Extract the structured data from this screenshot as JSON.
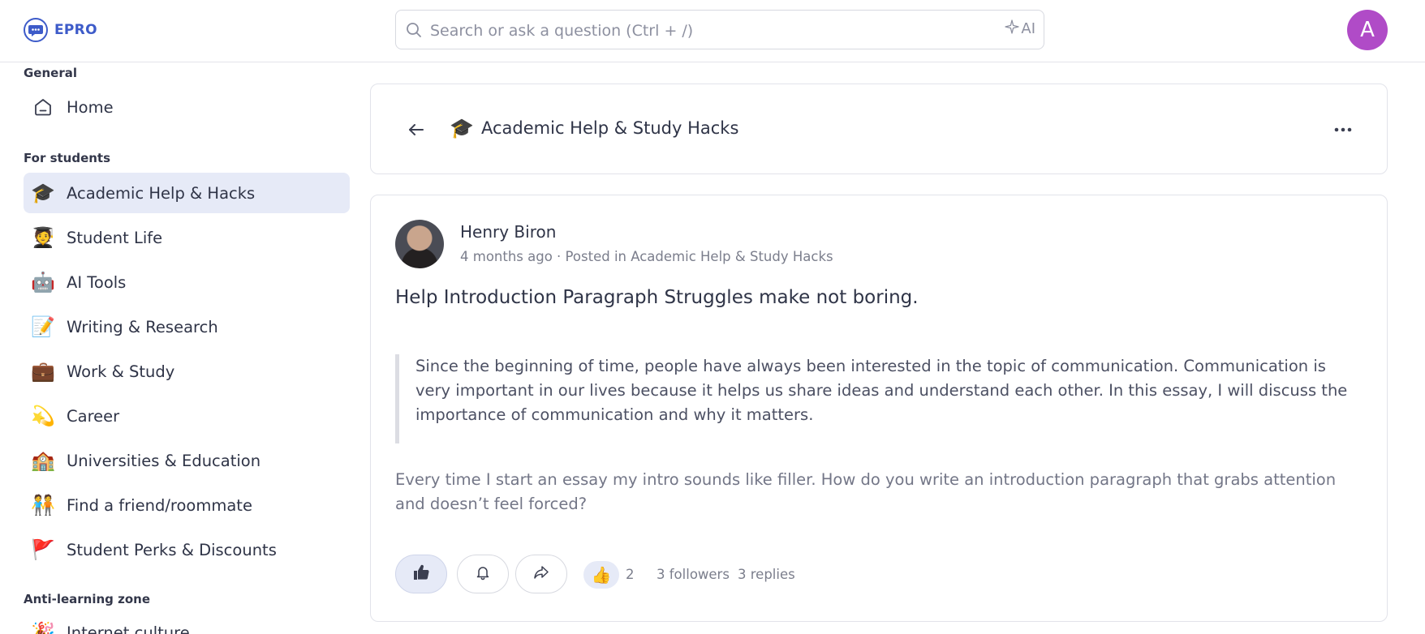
{
  "brand": {
    "name": "EPRO",
    "color": "#3d5bc9"
  },
  "search": {
    "placeholder": "Search or ask a question (Ctrl + /)",
    "ai_label": "AI"
  },
  "user": {
    "avatar_letter": "A",
    "avatar_color": "#b04bc7"
  },
  "sidebar": {
    "sections": [
      {
        "heading": "General"
      },
      {
        "heading": "For students"
      },
      {
        "heading": "Anti-learning zone"
      }
    ],
    "items": [
      {
        "label": "Home",
        "icon": "home-icon"
      },
      {
        "label": "Academic Help & Hacks",
        "icon": "graduation-cap-icon",
        "emoji": "🎓",
        "active": true
      },
      {
        "label": "Student Life",
        "icon": "student-icon",
        "emoji": "🧑‍🎓"
      },
      {
        "label": "AI Tools",
        "icon": "robot-icon",
        "emoji": "🤖"
      },
      {
        "label": "Writing & Research",
        "icon": "memo-icon",
        "emoji": "📝"
      },
      {
        "label": "Work & Study",
        "icon": "briefcase-icon",
        "emoji": "💼"
      },
      {
        "label": "Career",
        "icon": "dizzy-star-icon",
        "emoji": "💫"
      },
      {
        "label": "Universities & Education",
        "icon": "school-icon",
        "emoji": "🏫"
      },
      {
        "label": "Find a friend/roommate",
        "icon": "people-icon",
        "emoji": "🧑‍🤝‍🧑"
      },
      {
        "label": "Student Perks & Discounts",
        "icon": "flag-icon",
        "emoji": "🚩"
      },
      {
        "label": "Internet culture",
        "icon": "party-icon",
        "emoji": "🎉"
      }
    ]
  },
  "header": {
    "emoji": "🎓",
    "title": "Academic Help & Study Hacks"
  },
  "post": {
    "author": "Henry Biron",
    "meta": "4 months ago · Posted in Academic Help & Study Hacks",
    "title": "Help Introduction Paragraph Struggles make not boring.",
    "quote": "Since the beginning of time, people have always been interested in the topic of communication. Communication is very important in our lives because it helps us share ideas and understand each other. In this essay, I will discuss the importance of communication and why it matters.",
    "body": "Every time I start an essay my intro sounds like filler. How do you write an introduction paragraph that grabs attention and doesn’t feel forced?",
    "reaction_emoji": "👍",
    "reaction_count": "2",
    "followers": "3 followers",
    "replies": "3 replies"
  }
}
